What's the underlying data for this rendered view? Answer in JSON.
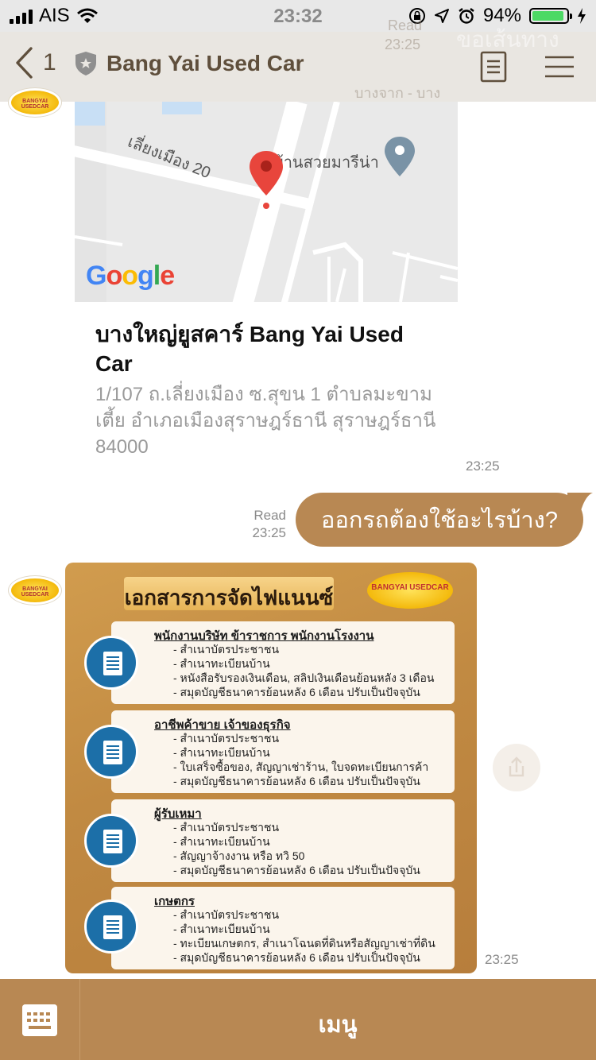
{
  "status_bar": {
    "carrier": "AIS",
    "time": "23:32",
    "battery": "94%",
    "battery_level": 0.94
  },
  "header": {
    "back_count": "1",
    "title": "Bang Yai Used Car",
    "behind_read": "Read",
    "behind_time": "23:25",
    "behind_text": "ขอเส้นทาง",
    "behind_snippet": "บางจาก - บาง"
  },
  "map_card": {
    "road_label": "เลี่ยงเมือง 20",
    "place_label": "บ้านสวยมารีน่า",
    "google": "Google",
    "title": "บางใหญ่ยูสคาร์ Bang Yai Used Car",
    "address": "1/107 ถ.เลี่ยงเมือง ซ.สุขน 1 ตำบลมะขามเตี้ย อำเภอเมืองสุราษฎร์ธานี สุราษฎร์ธานี 84000",
    "time": "23:25"
  },
  "my_message": {
    "read": "Read",
    "time": "23:25",
    "text": "ออกรถต้องใช้อะไรบ้าง?"
  },
  "avatar_logo": "BANGYAI USEDCAR",
  "poster": {
    "heading": "เอกสารการจัดไฟแนนซ์",
    "logo_text": "BANGYAI USEDCAR",
    "time": "23:25",
    "sections": [
      {
        "title": "พนักงานบริษัท ข้าราชการ พนักงานโรงงาน",
        "items": [
          "- สำเนาบัตรประชาชน",
          "- สำเนาทะเบียนบ้าน",
          "- หนังสือรับรองเงินเดือน, สลิปเงินเดือนย้อนหลัง 3 เดือน",
          "- สมุดบัญชีธนาคารย้อนหลัง 6 เดือน ปรับเป็นปัจจุบัน"
        ]
      },
      {
        "title": "อาชีพค้าขาย เจ้าของธุรกิจ",
        "items": [
          "- สำเนาบัตรประชาชน",
          "- สำเนาทะเบียนบ้าน",
          "- ใบเสร็จซื้อของ, สัญญาเช่าร้าน, ใบจดทะเบียนการค้า",
          "- สมุดบัญชีธนาคารย้อนหลัง 6 เดือน ปรับเป็นปัจจุบัน"
        ]
      },
      {
        "title": "ผู้รับเหมา",
        "items": [
          "- สำเนาบัตรประชาชน",
          "- สำเนาทะเบียนบ้าน",
          "- สัญญาจ้างงาน หรือ ทวิ 50",
          "- สมุดบัญชีธนาคารย้อนหลัง 6 เดือน ปรับเป็นปัจจุบัน"
        ]
      },
      {
        "title": "เกษตกร",
        "items": [
          "- สำเนาบัตรประชาชน",
          "- สำเนาทะเบียนบ้าน",
          "- ทะเบียนเกษตกร, สำเนาโฉนดที่ดินหรือสัญญาเช่าที่ดิน",
          "- สมุดบัญชีธนาคารย้อนหลัง 6 เดือน ปรับเป็นปัจจุบัน"
        ]
      }
    ]
  },
  "bottom_bar": {
    "menu_label": "เมนู"
  },
  "colors": {
    "brand": "#b88853",
    "header_bg": "#e9e6e1",
    "header_text": "#5a4a36",
    "pin_red": "#e8453c",
    "doc_blue": "#1c6fa8"
  }
}
